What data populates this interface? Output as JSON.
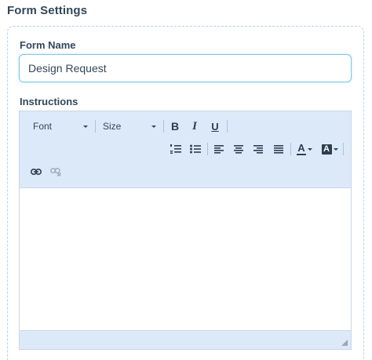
{
  "section": {
    "title": "Form Settings"
  },
  "form_name": {
    "label": "Form Name",
    "value": "Design Request"
  },
  "instructions": {
    "label": "Instructions",
    "toolbar": {
      "font_combo": "Font",
      "size_combo": "Size",
      "bold_glyph": "B",
      "italic_glyph": "I",
      "underline_glyph": "U",
      "text_color_glyph": "A",
      "bg_color_glyph": "A"
    },
    "body_text": ""
  },
  "colors": {
    "toolbar_bg": "#dce9f8",
    "input_focus_border": "#7fc4ec",
    "text": "#33475b"
  }
}
